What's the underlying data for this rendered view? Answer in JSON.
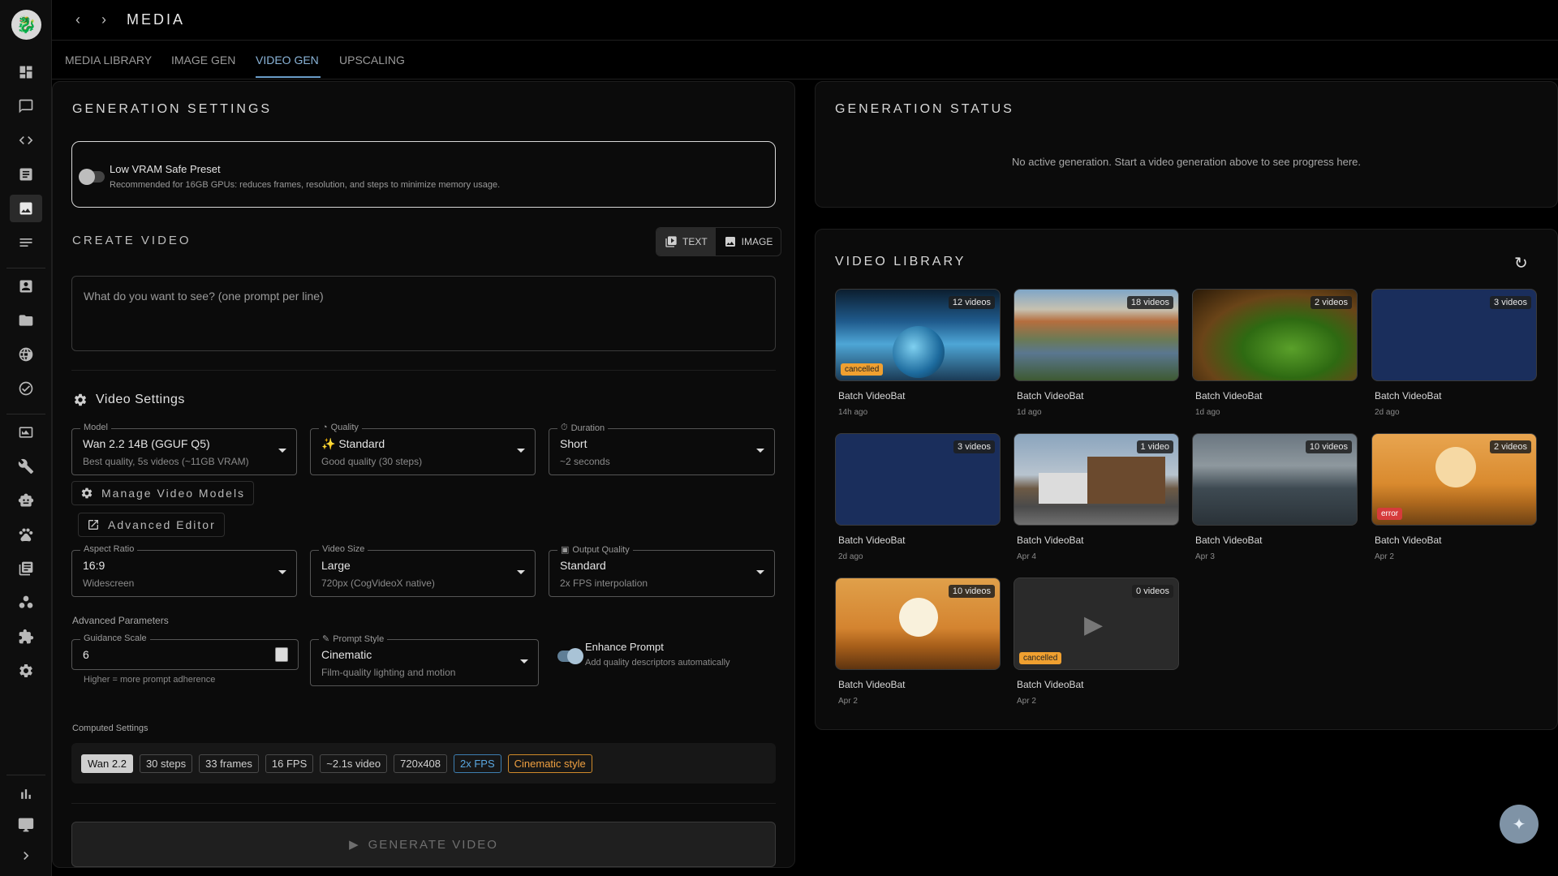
{
  "app": {
    "title": "MEDIA"
  },
  "tabs": [
    {
      "label": "MEDIA LIBRARY"
    },
    {
      "label": "IMAGE GEN"
    },
    {
      "label": "VIDEO GEN"
    },
    {
      "label": "UPSCALING"
    }
  ],
  "settings": {
    "title": "GENERATION SETTINGS",
    "preset": {
      "title": "Low VRAM Safe Preset",
      "desc": "Recommended for 16GB GPUs: reduces frames, resolution, and steps to minimize memory usage.",
      "enabled": false
    },
    "create": {
      "title": "CREATE VIDEO",
      "mode_text": "TEXT",
      "mode_image": "IMAGE",
      "prompt_placeholder": "What do you want to see? (one prompt per line)"
    },
    "video_settings_title": "Video Settings",
    "model": {
      "label": "Model",
      "value": "Wan 2.2 14B (GGUF Q5)",
      "sub": "Best quality, 5s videos (~11GB VRAM)"
    },
    "quality": {
      "label": "Quality",
      "value": "✨ Standard",
      "sub": "Good quality (30 steps)"
    },
    "duration": {
      "label": "Duration",
      "value": "Short",
      "sub": "~2 seconds"
    },
    "manage_models": "Manage Video Models",
    "advanced_editor": "Advanced Editor",
    "aspect": {
      "label": "Aspect Ratio",
      "value": "16:9",
      "sub": "Widescreen"
    },
    "size": {
      "label": "Video Size",
      "value": "Large",
      "sub": "720px (CogVideoX native)"
    },
    "output": {
      "label": "Output Quality",
      "value": "Standard",
      "sub": "2x FPS interpolation"
    },
    "advanced_title": "Advanced Parameters",
    "guidance": {
      "label": "Guidance Scale",
      "value": "6",
      "hint": "Higher = more prompt adherence"
    },
    "prompt_style": {
      "label": "Prompt Style",
      "value": "Cinematic",
      "sub": "Film-quality lighting and motion"
    },
    "enhance": {
      "title": "Enhance Prompt",
      "desc": "Add quality descriptors automatically",
      "enabled": true
    },
    "computed_title": "Computed Settings",
    "computed": [
      "Wan 2.2",
      "30 steps",
      "33 frames",
      "16 FPS",
      "~2.1s video",
      "720x408",
      "2x FPS",
      "Cinematic style"
    ],
    "generate": "GENERATE VIDEO"
  },
  "status": {
    "title": "GENERATION STATUS",
    "message": "No active generation. Start a video generation above to see progress here."
  },
  "library": {
    "title": "VIDEO LIBRARY",
    "items": [
      {
        "title": "Batch VideoBat",
        "date": "14h ago",
        "count": "12 videos",
        "badge": "cancelled"
      },
      {
        "title": "Batch VideoBat",
        "date": "1d ago",
        "count": "18 videos",
        "badge": ""
      },
      {
        "title": "Batch VideoBat",
        "date": "1d ago",
        "count": "2 videos",
        "badge": ""
      },
      {
        "title": "Batch VideoBat",
        "date": "2d ago",
        "count": "3 videos",
        "badge": ""
      },
      {
        "title": "Batch VideoBat",
        "date": "2d ago",
        "count": "3 videos",
        "badge": ""
      },
      {
        "title": "Batch VideoBat",
        "date": "Apr 4",
        "count": "1 video",
        "badge": ""
      },
      {
        "title": "Batch VideoBat",
        "date": "Apr 3",
        "count": "10 videos",
        "badge": ""
      },
      {
        "title": "Batch VideoBat",
        "date": "Apr 2",
        "count": "2 videos",
        "badge": "error"
      },
      {
        "title": "Batch VideoBat",
        "date": "Apr 2",
        "count": "10 videos",
        "badge": ""
      },
      {
        "title": "Batch VideoBat",
        "date": "Apr 2",
        "count": "0 videos",
        "badge": "cancelled"
      }
    ]
  },
  "colors": {
    "accent": "#6a9cc8",
    "cancelled": "#f0a030",
    "error": "#d63b3b"
  }
}
